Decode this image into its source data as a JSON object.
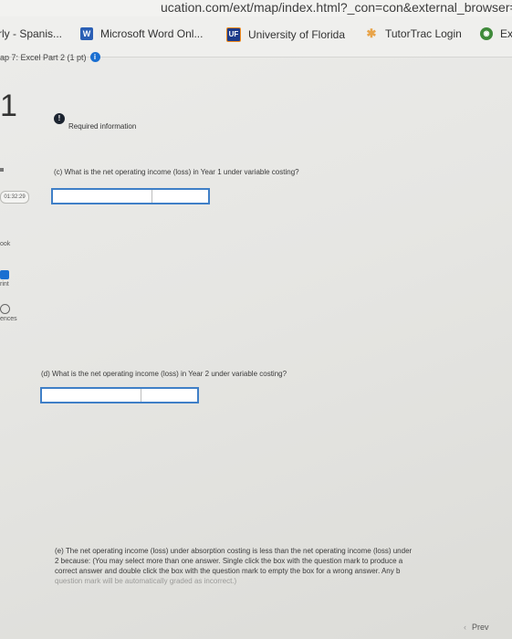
{
  "browser": {
    "url": "ucation.com/ext/map/index.html?_con=con&external_browser=0&",
    "bookmarks": [
      {
        "label": "rly - Spanis..."
      },
      {
        "label": "Microsoft Word Onl..."
      },
      {
        "label": "University of Florida"
      },
      {
        "label": "TutorTrac Login"
      },
      {
        "label": "Ex"
      }
    ]
  },
  "header": {
    "breadcrumb": "ap 7: Excel Part 2 (1 pt)"
  },
  "sidebar": {
    "question_number": "1",
    "timer": "01:32:29",
    "items": [
      {
        "label": "ook"
      },
      {
        "label": "rint"
      },
      {
        "label": "ences"
      }
    ]
  },
  "main": {
    "required_info": "Required information",
    "question_c": "(c) What is the net operating income (loss) in Year 1 under variable costing?",
    "question_d": "(d) What is the net operating income (loss) in Year 2 under variable costing?",
    "note_line1": "(e) The net operating income (loss) under absorption costing is less than the net operating income (loss) under",
    "note_line2": "2 because: (You may select more than one answer. Single click the box with the question mark to produce a",
    "note_line3": "correct answer and double click the box with the question mark to empty the box for a wrong answer. Any b",
    "note_line4": "question mark will be automatically graded as incorrect.)"
  },
  "footer": {
    "prev_label": "Prev"
  },
  "colors": {
    "accent": "#1a6fd1",
    "input_border": "#3f7fc7"
  }
}
